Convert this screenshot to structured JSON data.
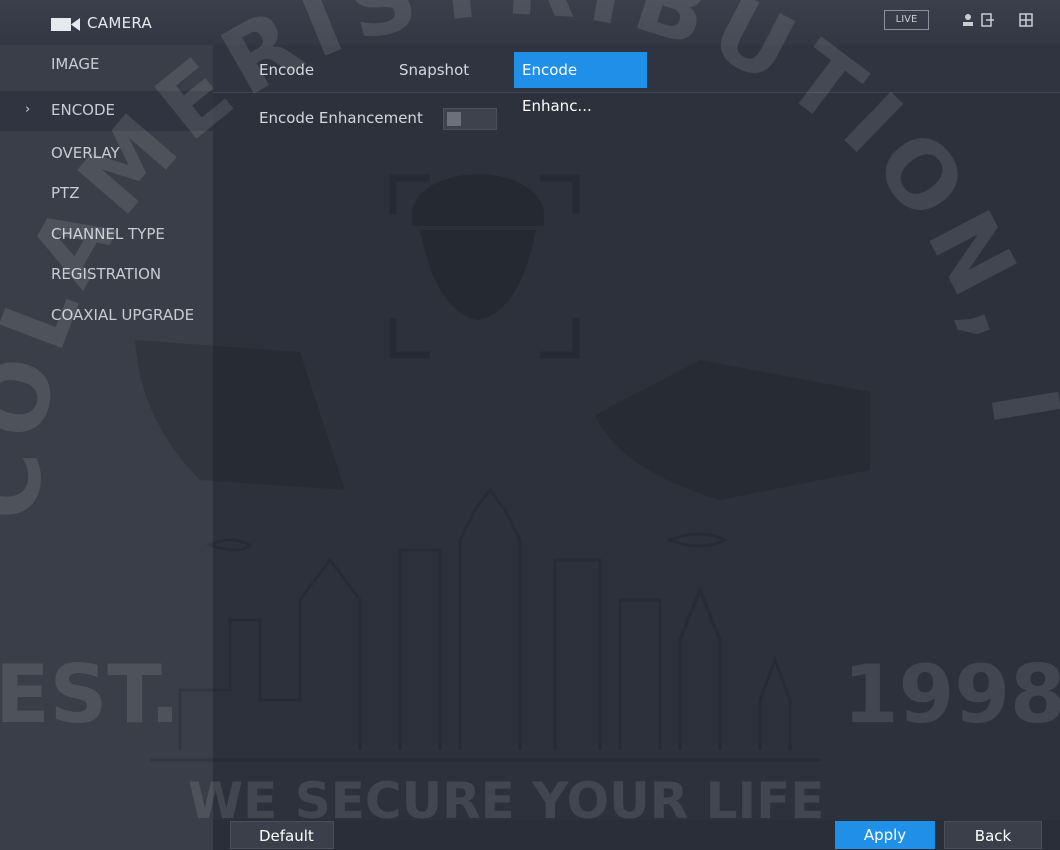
{
  "header": {
    "title": "CAMERA",
    "live_label": "LIVE",
    "icons": [
      "camera-icon",
      "user-icon",
      "shortcut-icon",
      "window-icon"
    ]
  },
  "sidebar": {
    "items": [
      {
        "label": "IMAGE"
      },
      {
        "label": "ENCODE",
        "active": true
      },
      {
        "label": "OVERLAY"
      },
      {
        "label": "PTZ"
      },
      {
        "label": "CHANNEL TYPE"
      },
      {
        "label": "REGISTRATION"
      },
      {
        "label": "COAXIAL UPGRADE"
      }
    ],
    "active_marker": "›"
  },
  "tabs": [
    {
      "label": "Encode"
    },
    {
      "label": "Snapshot"
    },
    {
      "label": "Encode Enhanc...",
      "active": true
    }
  ],
  "settings": {
    "encode_enhancement_label": "Encode Enhancement",
    "encode_enhancement_enabled": false
  },
  "watermark": {
    "arc_text": "COLAMERISTRIBUTION, INC",
    "left_text": "EST.",
    "right_text": "1998",
    "bottom_text": "WE SECURE YOUR LIFE"
  },
  "footer": {
    "default_label": "Default",
    "apply_label": "Apply",
    "back_label": "Back"
  },
  "colors": {
    "accent": "#1f8fe8",
    "background": "#2f3440",
    "sidebar": "#3a3e48"
  }
}
